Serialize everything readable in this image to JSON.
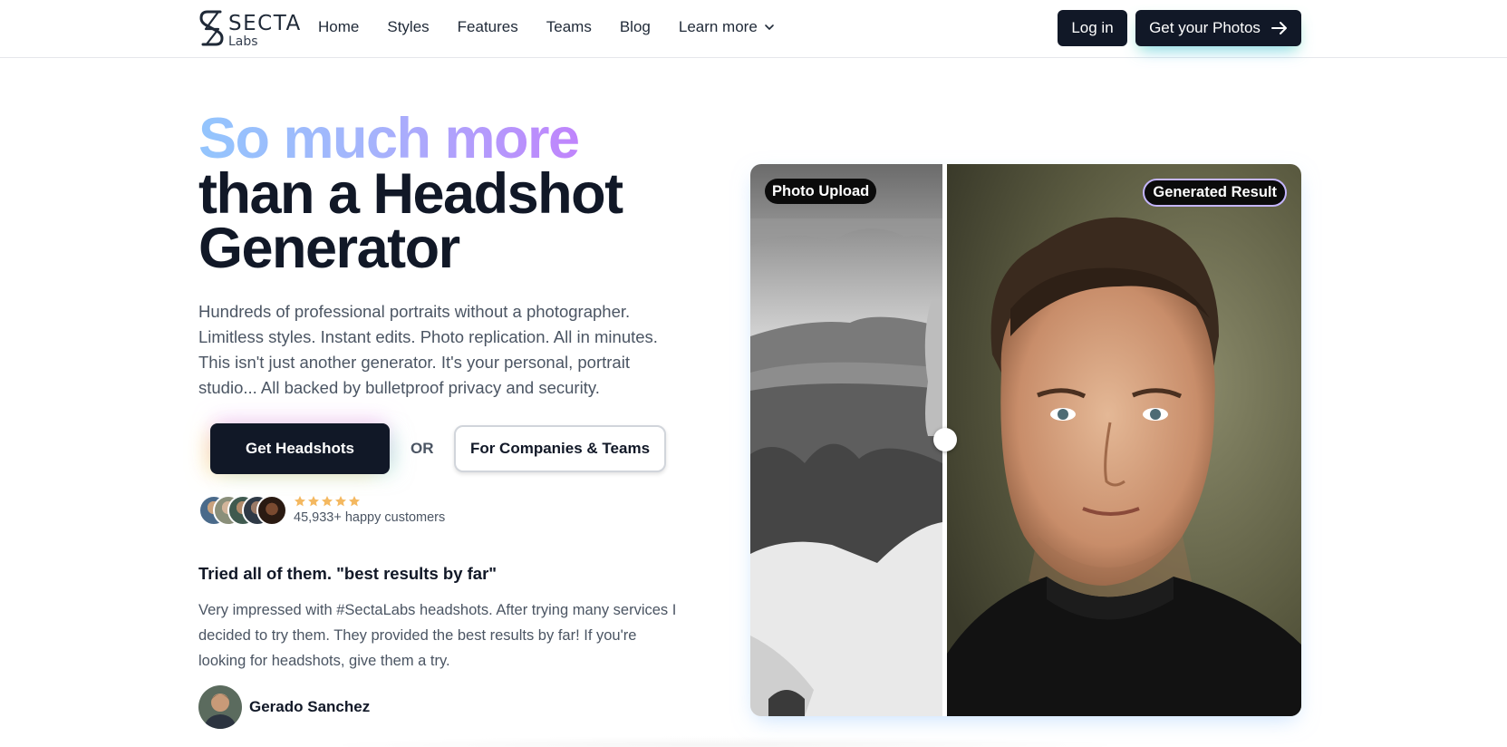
{
  "nav": {
    "logo_text": "SECTA",
    "logo_sub": "Labs",
    "links": [
      "Home",
      "Styles",
      "Features",
      "Teams",
      "Blog"
    ],
    "learn_more": "Learn more",
    "login": "Log in",
    "cta": "Get your Photos"
  },
  "hero": {
    "title_gradient": "So much more",
    "title_line2": "than a Headshot",
    "title_line3": "Generator",
    "description": "Hundreds of professional portraits without a photographer. Limitless styles. Instant edits. Photo replication. All in minutes. This isn't just another generator. It's your personal, portrait studio... All backed by bulletproof privacy and security.",
    "primary_button": "Get Headshots",
    "or_text": "OR",
    "secondary_button": "For Companies & Teams",
    "rating_stars": 5,
    "customers": "45,933+ happy customers"
  },
  "testimonial": {
    "title": "Tried all of them. \"best results by far\"",
    "body": "Very impressed with #SectaLabs headshots. After trying many services I decided to try them. They provided the best results by far! If you're looking for headshots, give them a try.",
    "author": "Gerado Sanchez"
  },
  "comparison": {
    "left_label": "Photo Upload",
    "right_label": "Generated Result"
  },
  "colors": {
    "dark": "#111827",
    "star": "#f4b860",
    "gradient_start": "#93c5fd",
    "gradient_end": "#c084fc",
    "result_badge_border": "#c4b5fd"
  },
  "icons": [
    "logo-mark-icon",
    "chevron-down-icon",
    "arrow-right-icon",
    "star-icon"
  ]
}
